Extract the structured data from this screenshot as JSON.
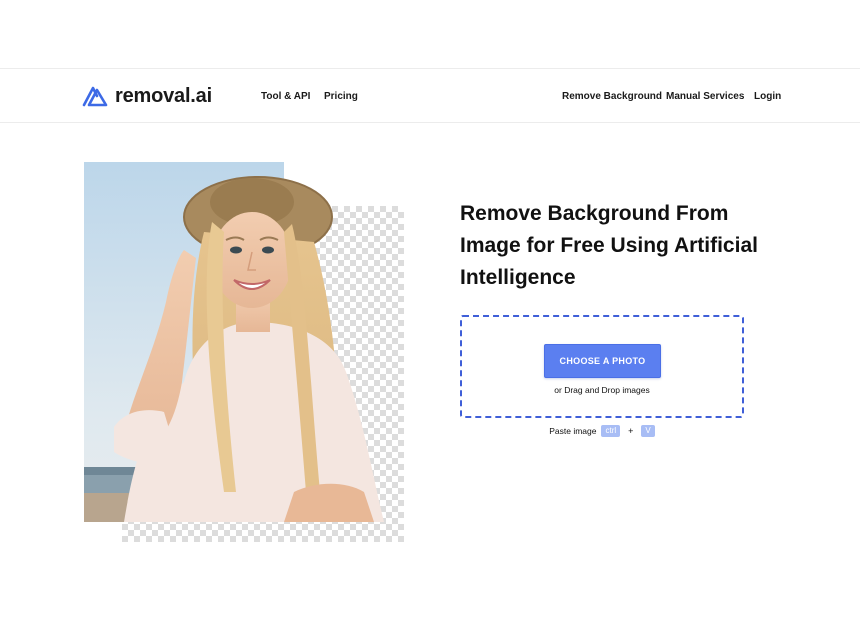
{
  "header": {
    "logo_text": "removal.ai",
    "nav_left": [
      "Tool & API",
      "Pricing"
    ],
    "nav_right": [
      "Remove Background",
      "Manual Services",
      "Login"
    ]
  },
  "hero": {
    "headline": "Remove Background From Image for Free Using Artificial Intelligence",
    "upload": {
      "button_label": "CHOOSE A PHOTO",
      "drop_hint": "or Drag and Drop images"
    },
    "paste": {
      "label": "Paste image",
      "key1": "ctrl",
      "plus": "+",
      "key2": "V"
    }
  },
  "colors": {
    "accent": "#5b7ff0",
    "dropzone_border": "#3f5fd8",
    "key_bg": "#a8bdf5"
  },
  "icons": [
    "removal-logo-icon"
  ]
}
